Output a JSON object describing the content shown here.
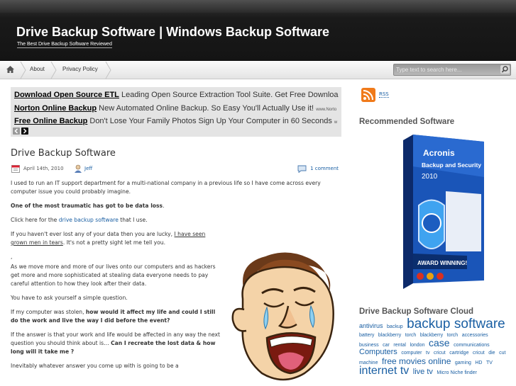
{
  "header": {
    "site_title": "Drive Backup Software | Windows Backup Software",
    "tagline": "The Best Drive Backup Software Reviewed"
  },
  "nav": {
    "home_icon": "home-icon",
    "items": [
      {
        "label": "About"
      },
      {
        "label": "Privacy Policy"
      }
    ],
    "search_placeholder": "Type text to search here...",
    "search_icon": "search-icon"
  },
  "ads": {
    "rows": [
      {
        "title": "Download Open Source ETL",
        "text": " Leading Open Source Extraction Tool Suite. Get Free Downloa",
        "url": ""
      },
      {
        "title": "Norton Online Backup",
        "text": " New Automated Online Backup. So Easy You'll Actually Use it! ",
        "url": "www.Norto"
      },
      {
        "title": "Free Online Backup",
        "text": " Don't Lose Your Family Photos Sign Up Your Computer in 60 Seconds ",
        "url": "w"
      }
    ]
  },
  "post": {
    "title": "Drive Backup Software",
    "date": "April 14th, 2010",
    "author": "Jeff",
    "comments": "1 comment",
    "p1": "I used to run an IT support department for a multi-national company in a previous life so I have come across every computer issue you could probably imagine.",
    "p2": "One of the most traumatic has got to be data loss",
    "p2_end": ".",
    "p3_a": "Click here for the ",
    "p3_link": "drive backup software",
    "p3_b": " that I use.",
    "p4_a": "If you haven't ever lost any of your data then you are lucky, ",
    "p4_link": "I have seen grown men in tears",
    "p4_b": ". It's not a pretty sight let me tell you.",
    "p5": ",",
    "p6": "As we move more and more of our lives onto our computers and as hackers get more and more sophisticated at stealing data everyone needs to pay careful attention to how they look after their data.",
    "p7": "You have to ask yourself a simple question.",
    "p8_a": "If my computer was stolen, ",
    "p8_b": "how would it affect my life and could I still do the work and live the way I did before the event?",
    "p9_a": "If the answer is that your work and life would be affected in any way the next question you should think about is… ",
    "p9_b": "Can I recreate the lost data & how long will it take me ?",
    "p10": "Inevitably whatever answer you come up with is going to be a"
  },
  "sidebar": {
    "rss_label": "RSS",
    "recommended_heading": "Recommended Software",
    "box_brand": "Acronis",
    "box_title": "Backup and Security",
    "box_year": "2010",
    "box_award": "AWARD WINNING!",
    "cloud_heading": "Drive Backup Software Cloud",
    "tags": [
      {
        "t": "antivirus",
        "s": 9
      },
      {
        "t": "backup",
        "s": 7
      },
      {
        "t": "backup",
        "s": 19
      },
      {
        "t": "software",
        "s": 19
      },
      {
        "t": "battery",
        "s": 7
      },
      {
        "t": "blackberry",
        "s": 7
      },
      {
        "t": "torch",
        "s": 7
      },
      {
        "t": "blackberry",
        "s": 7
      },
      {
        "t": "torch",
        "s": 7
      },
      {
        "t": "accessories",
        "s": 7
      },
      {
        "t": "business",
        "s": 7
      },
      {
        "t": "car",
        "s": 7
      },
      {
        "t": "rental",
        "s": 7
      },
      {
        "t": "london",
        "s": 7
      },
      {
        "t": "case",
        "s": 14
      },
      {
        "t": "communications",
        "s": 7
      },
      {
        "t": "Computers",
        "s": 11
      },
      {
        "t": "computer",
        "s": 7
      },
      {
        "t": "tv",
        "s": 7
      },
      {
        "t": "cricut",
        "s": 7
      },
      {
        "t": "cartridge",
        "s": 7
      },
      {
        "t": "cricut",
        "s": 7
      },
      {
        "t": "die",
        "s": 7
      },
      {
        "t": "cut",
        "s": 7
      },
      {
        "t": "machine",
        "s": 7
      },
      {
        "t": "free movies online",
        "s": 12
      },
      {
        "t": "gaming",
        "s": 7
      },
      {
        "t": "HD",
        "s": 7
      },
      {
        "t": "TV",
        "s": 7
      },
      {
        "t": "internet tv",
        "s": 16
      },
      {
        "t": "live tv",
        "s": 11
      },
      {
        "t": "Micro Niche finder",
        "s": 7
      }
    ]
  }
}
